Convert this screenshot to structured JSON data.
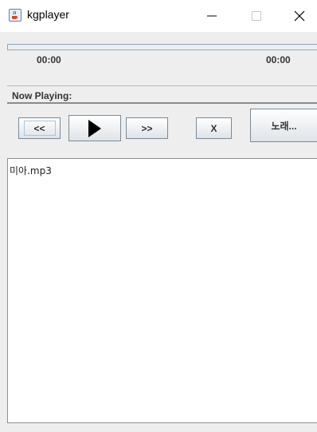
{
  "window": {
    "title": "kgplayer",
    "icon": "java-cup-icon",
    "controls": [
      "minimize-icon",
      "maximize-icon",
      "close-icon"
    ]
  },
  "progress": {
    "fraction": 0,
    "elapsed": "00:00",
    "total": "00:00"
  },
  "now_playing": {
    "label": "Now Playing:"
  },
  "controls": {
    "prev_label": "<<",
    "play_icon": "play-icon",
    "next_label": ">>",
    "remove_label": "X",
    "song_label": "노래..."
  },
  "playlist": {
    "items": [
      "미아.mp3"
    ]
  },
  "colors": {
    "panel": "#eeeeee",
    "progress_border": "#8ea7c2",
    "button_border": "#7a8a99"
  }
}
